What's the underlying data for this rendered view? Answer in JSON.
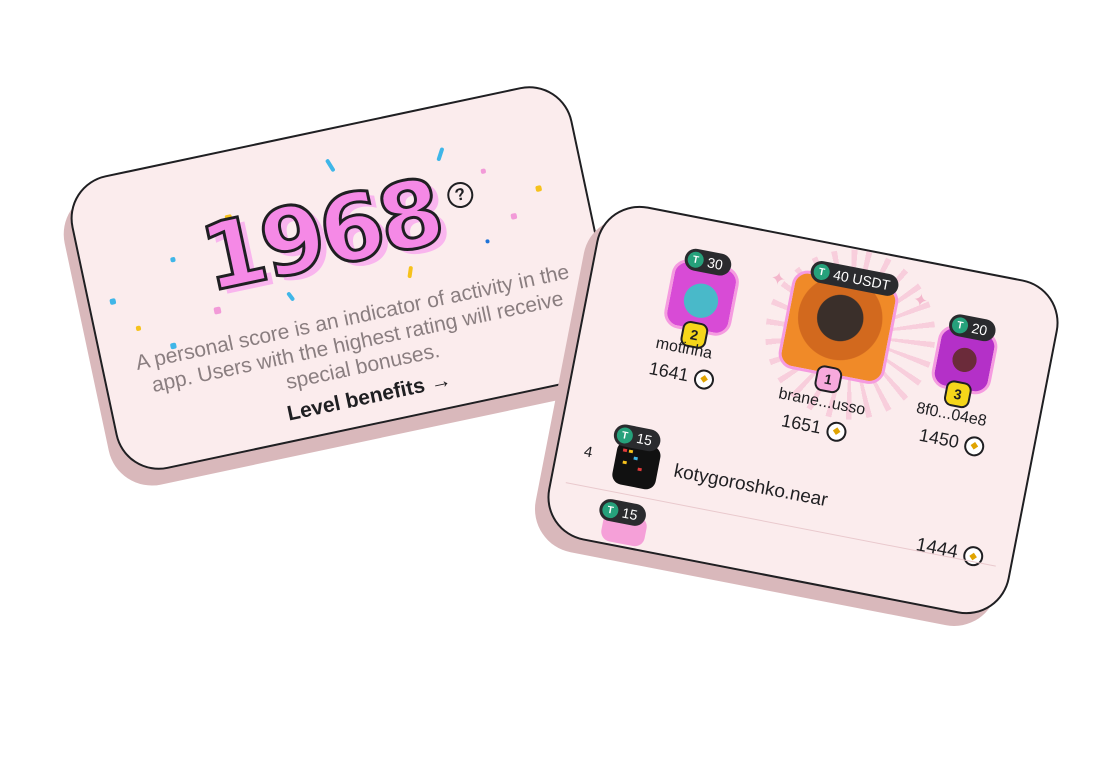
{
  "score_card": {
    "score": "1968",
    "help_icon": "question-circle-icon",
    "description": "A personal score is an indicator of activity in the app. Users with the highest rating will receive special bonuses.",
    "link_label": "Level benefits",
    "link_icon": "arrow-right-icon"
  },
  "leaderboard": {
    "podium": [
      {
        "rank": "1",
        "name": "brane...usso",
        "score": "1651",
        "prize": "40 USDT"
      },
      {
        "rank": "2",
        "name": "motinha",
        "score": "1641",
        "prize": "30"
      },
      {
        "rank": "3",
        "name": "8f0...04e8",
        "score": "1450",
        "prize": "20"
      }
    ],
    "rows": [
      {
        "rank": "4",
        "name": "kotygoroshko.near",
        "score": "1444",
        "prize": "15"
      },
      {
        "rank": "",
        "name": "",
        "score": "",
        "prize": "15"
      }
    ],
    "token_icon": "tether-icon",
    "coin_icon": "coin-icon"
  },
  "colors": {
    "card_bg": "#fbeced",
    "accent_pink": "#f589e6",
    "gold": "#f5d61a",
    "tether_green": "#26a17b"
  }
}
